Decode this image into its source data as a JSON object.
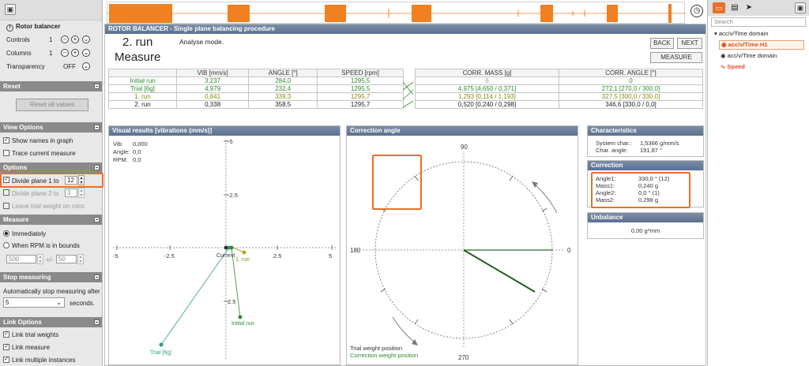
{
  "left_panel": {
    "title": "Rotor balancer",
    "controls_label": "Controls",
    "controls_value": "1",
    "columns_label": "Columns",
    "columns_value": "1",
    "transparency_label": "Transparency",
    "transparency_value": "OFF",
    "reset_section": "Reset",
    "reset_button": "Reset all values",
    "view_section": "View Options",
    "show_names": "Show names in graph",
    "trace_measure": "Trace current measure",
    "options_section": "Options",
    "divide_plane1": "Divide plane 1 to",
    "divide_plane1_value": "12",
    "divide_plane2": "Divide plane 2 to",
    "divide_plane2_value": "3",
    "leave_trial": "Leave trial weight on rotor",
    "measure_section": "Measure",
    "immediately": "Immediately",
    "when_rpm": "When RPM is in bounds",
    "rpm_low": "500",
    "rpm_sep": "+/-",
    "rpm_tol": "50",
    "stop_section": "Stop measuring",
    "auto_stop": "Automatically stop measuring after",
    "stop_value": "5",
    "stop_unit": "seconds.",
    "link_section": "Link Options",
    "link_trial": "Link trial weights",
    "link_measure": "Link measure",
    "link_multiple": "Link multiple instances"
  },
  "main": {
    "header": "ROTOR BALANCER - Single plane balancing procedure",
    "step_title": "2. run",
    "step_subtitle": "Measure",
    "mode": "Analyse mode.",
    "back": "BACK",
    "next": "NEXT",
    "measure": "MEASURE",
    "table": {
      "headers": [
        "",
        "VIB [mm/s]",
        "ANGLE [°]",
        "SPEED [rpm]"
      ],
      "rows": [
        {
          "name": "Initial run",
          "vib": "3,237",
          "angle": "284,0",
          "speed": "1295,5",
          "color": "#2e8b2e"
        },
        {
          "name": "Trial [6g]",
          "vib": "4,979",
          "angle": "232,4",
          "speed": "1295,5",
          "color": "#2e8b2e"
        },
        {
          "name": "1. run",
          "vib": "0,841",
          "angle": "339,3",
          "speed": "1295,7",
          "color": "#8a8a1a"
        },
        {
          "name": "2. run",
          "vib": "0,338",
          "angle": "358,5",
          "speed": "1295,7",
          "color": "#222"
        }
      ]
    },
    "corr_table": {
      "headers": [
        "CORR. MASS [g]",
        "CORR. ANGLE [°]"
      ],
      "rows": [
        {
          "mass": "6",
          "angle": "0",
          "color": "#2e8b2e"
        },
        {
          "mass": "4,975 [4,650 / 0,371]",
          "angle": "272,1 [270,0 / 300,0]",
          "color": "#2e8b2e"
        },
        {
          "mass": "1,293 [0,114 / 1,193]",
          "angle": "327,5 [300,0 / 330,0]",
          "color": "#8a8a1a"
        },
        {
          "mass": "0,520 [0,240 / 0,298]",
          "angle": "346,6 [330,0 / 0,0]",
          "color": "#222"
        }
      ]
    }
  },
  "visual": {
    "title": "Visual results [vibrations (mm/s)]",
    "vib_label": "Vib:",
    "vib_value": "0,000",
    "angle_label": "Angle:",
    "angle_value": "0,0",
    "rpm_label": "RPM:",
    "rpm_value": "0,0",
    "ticks_x": [
      "-5",
      "-2.5",
      "2.5",
      "5"
    ],
    "ticks_y_top": [
      "-5",
      "-2.5"
    ],
    "ticks_y_bottom": [
      "2.5"
    ],
    "labels": {
      "current": "Current",
      "run1": "1. run",
      "initial": "Initial run",
      "trial": "Trial [6g]"
    }
  },
  "correction_angle": {
    "title": "Correction angle",
    "deg90": "90",
    "deg0": "0",
    "deg180": "180",
    "deg270": "270",
    "legend_trial": "Trial weight position",
    "legend_corr": "Correction weight position"
  },
  "characteristics": {
    "title": "Characteristics",
    "sys_label": "System char.:",
    "sys_value": "1,5366 g/mm/s",
    "char_label": "Char. angle:",
    "char_value": "191,87 °"
  },
  "correction": {
    "title": "Correction",
    "angle1_label": "Angle1:",
    "angle1_value": "330,0 ° (12)",
    "mass1_label": "Mass1:",
    "mass1_value": "0,240 g",
    "angle2_label": "Angle2:",
    "angle2_value": "0,0 ° (1)",
    "mass2_label": "Mass2:",
    "mass2_value": "0,298 g"
  },
  "unbalance": {
    "title": "Unbalance",
    "value": "0,00 g*mm"
  },
  "right_panel": {
    "search_placeholder": "Search",
    "tree_root": "acc/v/Time domain",
    "tree_child1": "acc/v/Time H1",
    "tree_child2": "acc/v/Time domain",
    "tree_child3": "Speed"
  },
  "colors": {
    "accent": "#e8702a",
    "header_blue": "#5c7090",
    "green": "#2e8b2e",
    "teal": "#2e9a8a"
  }
}
